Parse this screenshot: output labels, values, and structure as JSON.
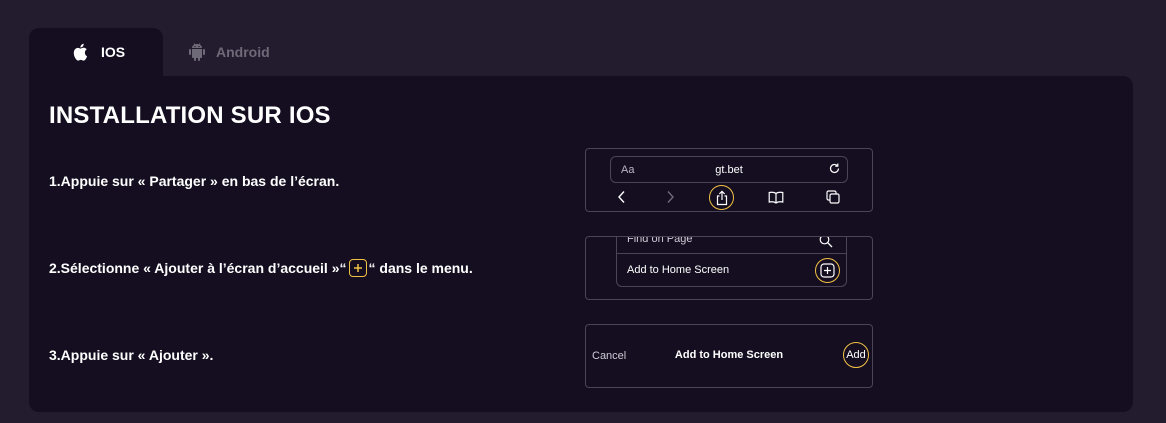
{
  "tabs": [
    {
      "label": "IOS",
      "icon": "apple-icon",
      "active": true
    },
    {
      "label": "Android",
      "icon": "android-icon",
      "active": false
    }
  ],
  "title": "INSTALLATION SUR IOS",
  "steps": [
    {
      "text": "1.Appuie sur « Partager » en bas de l’écran."
    },
    {
      "text_before": "2.Sélectionne « Ajouter à l’écran d’accueil »“",
      "text_after": "“ dans le menu."
    },
    {
      "text": "3.Appuie sur « Ajouter »."
    }
  ],
  "browser_bar": {
    "text_size_label": "Aa",
    "url": "gt.bet"
  },
  "share_menu": {
    "find_label": "Find on Page",
    "add_label": "Add to Home Screen"
  },
  "add_sheet": {
    "cancel_label": "Cancel",
    "title": "Add to Home Screen",
    "add_label": "Add"
  },
  "colors": {
    "background": "#231b2e",
    "panel": "#140e20",
    "accent": "#f2c246",
    "border": "#4a4458",
    "inactive_tab": "#6f6a78"
  }
}
